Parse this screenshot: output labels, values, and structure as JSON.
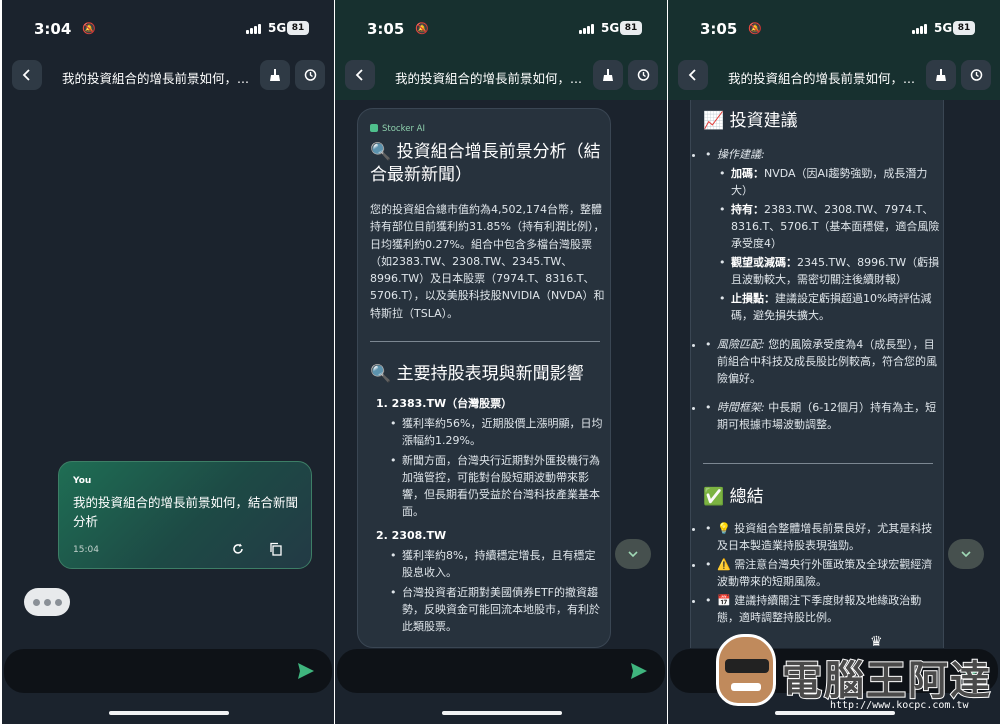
{
  "status": {
    "time": "3:05",
    "time_first": "3:04",
    "network": "5G",
    "battery": "81"
  },
  "header": {
    "title": "我的投資組合的增長前景如何，..."
  },
  "chat": {
    "user_label": "You",
    "user_message": "我的投資組合的增長前景如何，結合新聞分析",
    "user_time": "15:04"
  },
  "ai": {
    "brand": "Stocker AI",
    "heading": "🔍 投資組合增長前景分析（結合最新新聞）",
    "summary": "您的投資組合總市值約為4,502,174台幣，整體持有部位目前獲利約31.85%（持有利潤比例），日均獲利約0.27%。組合中包含多檔台灣股票（如2383.TW、2308.TW、2345.TW、8996.TW）及日本股票（7974.T、8316.T、5706.T），以及美股科技股NVIDIA（NVDA）和特斯拉（TSLA）。",
    "heading2": "🔍 主要持股表現與新聞影響",
    "stocks": [
      {
        "name": "1.  2383.TW（台灣股票）",
        "points": [
          "獲利率約56%，近期股價上漲明顯，日均漲幅約1.29%。",
          "新聞方面，台灣央行近期對外匯投機行為加強管控，可能對台股短期波動帶來影響，但長期看仍受益於台灣科技產業基本面。"
        ]
      },
      {
        "name": "2.  2308.TW",
        "points": [
          "獲利率約8%，持續穩定增長，且有穩定股息收入。",
          "台灣投資者近期對美國債券ETF的撤資趨勢，反映資金可能回流本地股市，有利於此類股票。"
        ]
      }
    ],
    "advice_heading": "📈 投資建議",
    "advice_op_label": "操作建議:",
    "advice_ops": [
      {
        "label": "加碼：",
        "text": "NVDA（因AI趨勢強勁，成長潛力大）"
      },
      {
        "label": "持有：",
        "text": "2383.TW、2308.TW、7974.T、8316.T、5706.T（基本面穩健，適合風險承受度4）"
      },
      {
        "label": "觀望或減碼：",
        "text": "2345.TW、8996.TW（虧損且波動較大，需密切關注後續財報）"
      },
      {
        "label": "止損點：",
        "text": "建議設定虧損超過10%時評估減碼，避免損失擴大。"
      }
    ],
    "risk_label": "風險匹配:",
    "risk_text": " 您的風險承受度為4（成長型），目前組合中科技及成長股比例較高，符合您的風險偏好。",
    "horizon_label": "時間框架:",
    "horizon_text": " 中長期（6-12個月）持有為主，短期可根據市場波動調整。",
    "conclusion_heading": "✅ 總結",
    "conclusions": [
      "💡 投資組合整體增長前景良好，尤其是科技及日本製造業持股表現強勁。",
      "⚠️ 需注意台灣央行外匯政策及全球宏觀經濟波動帶來的短期風險。",
      "📅 建議持續關注下季度財報及地緣政治動態，適時調整持股比例。"
    ]
  },
  "watermark": {
    "name": "電腦王阿達",
    "url": "http://www.kocpc.com.tw"
  },
  "colors": {
    "accent": "#4fc08d",
    "background": "#1b232d",
    "card": "#27323d",
    "bubble": "#1f6e54"
  },
  "icons": [
    "back-icon",
    "clean-icon",
    "history-icon",
    "send-icon",
    "regenerate-icon",
    "copy-icon",
    "chevron-down-icon"
  ]
}
